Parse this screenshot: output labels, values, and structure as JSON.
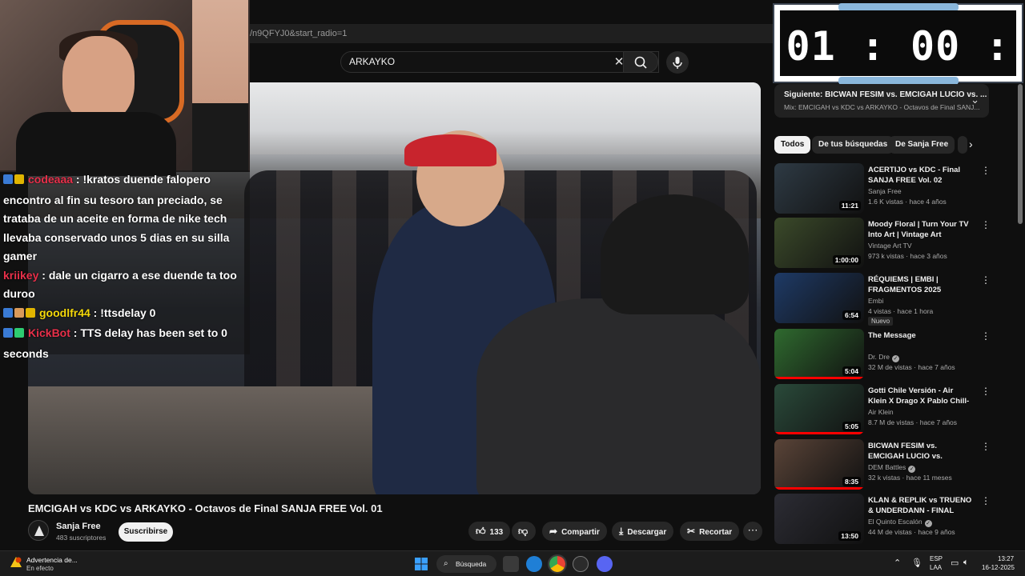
{
  "browser": {
    "url_fragment": "/n9QFYJ0&start_radio=1"
  },
  "search": {
    "value": "ARKAYKO"
  },
  "timer": {
    "display": "01 : 00 : 00"
  },
  "chat": [
    {
      "user": "codeaaa",
      "user_color": "#e8304a",
      "text": " : !kratos duende falopero encontro al fin su tesoro tan preciado, se trataba de un aceite en forma de nike tech llevaba conservado unos 5 dias en su silla gamer"
    },
    {
      "user": "kriikey",
      "user_color": "#e8304a",
      "text": " : dale un cigarro a ese duende ta too duroo"
    },
    {
      "user": "goodlfr44",
      "user_color": "#f5d90a",
      "text": " : !ttsdelay 0"
    },
    {
      "user": "KickBot",
      "user_color": "#e8304a",
      "text": " : TTS delay has been set to 0 seconds"
    }
  ],
  "upnext": {
    "title": "Siguiente: BICWAN FESIM vs. EMCIGAH LUCIO vs. ...",
    "subtitle": "Mix: EMCIGAH vs KDC vs ARKAYKO - Octavos de Final SANJ..."
  },
  "chips": [
    "Todos",
    "De tus búsquedas",
    "De Sanja Free"
  ],
  "recommendations": [
    {
      "title": "ACERTIJO vs KDC - Final SANJA FREE Vol. 02",
      "channel": "Sanja Free",
      "meta": "1.6 K vistas · hace 4 años",
      "duration": "11:21",
      "verified": false,
      "badge": "",
      "thumb": "#2e3a44"
    },
    {
      "title": "Moody Floral | Turn Your TV Into Art | Vintage Art Slideshow Fo...",
      "channel": "Vintage Art TV",
      "meta": "973 k vistas · hace 3 años",
      "duration": "1:00:00",
      "verified": false,
      "badge": "",
      "thumb": "#3b4a2a"
    },
    {
      "title": "RÉQUIEMS | EMBI | FRAGMENTOS 2025",
      "channel": "Embi",
      "meta": "4 vistas · hace 1 hora",
      "duration": "6:54",
      "verified": false,
      "badge": "Nuevo",
      "thumb": "#1e3a66"
    },
    {
      "title": "The Message",
      "channel": "Dr. Dre",
      "meta": "32 M de vistas · hace 7 años",
      "duration": "5:04",
      "verified": true,
      "badge": "",
      "thumb": "#2f6a2f"
    },
    {
      "title": "Gotti Chile Versión - Air Klein X Drago X Pablo Chill-E",
      "channel": "Air Klein",
      "meta": "8.7 M de vistas · hace 7 años",
      "duration": "5:05",
      "verified": false,
      "badge": "",
      "thumb": "#2a4a3a"
    },
    {
      "title": "BICWAN FESIM vs. EMCIGAH LUCIO vs. MALAKORDE ...",
      "channel": "DEM Battles",
      "meta": "32 k vistas · hace 11 meses",
      "duration": "8:35",
      "verified": true,
      "badge": "",
      "thumb": "#5a4438"
    },
    {
      "title": "KLAN & REPLIK vs TRUENO & UNDERDANN - FINAL (2VS1 - ...",
      "channel": "El Quinto Escalón",
      "meta": "44 M de vistas · hace 9 años",
      "duration": "13:50",
      "verified": true,
      "badge": "",
      "thumb": "#2c2c34"
    }
  ],
  "video": {
    "title": "EMCIGAH vs KDC vs ARKAYKO - Octavos de Final SANJA FREE Vol. 01",
    "channel": "Sanja Free",
    "subscribers": "483 suscriptores",
    "subscribe_label": "Suscribirse",
    "likes": "133",
    "share_label": "Compartir",
    "download_label": "Descargar",
    "clip_label": "Recortar"
  },
  "taskbar": {
    "warning_title": "Advertencia de...",
    "warning_sub": "En efecto",
    "search_label": "Búsqueda",
    "lang_1": "ESP",
    "lang_2": "LAA",
    "time": "13:27",
    "date": "16-12-2025"
  }
}
